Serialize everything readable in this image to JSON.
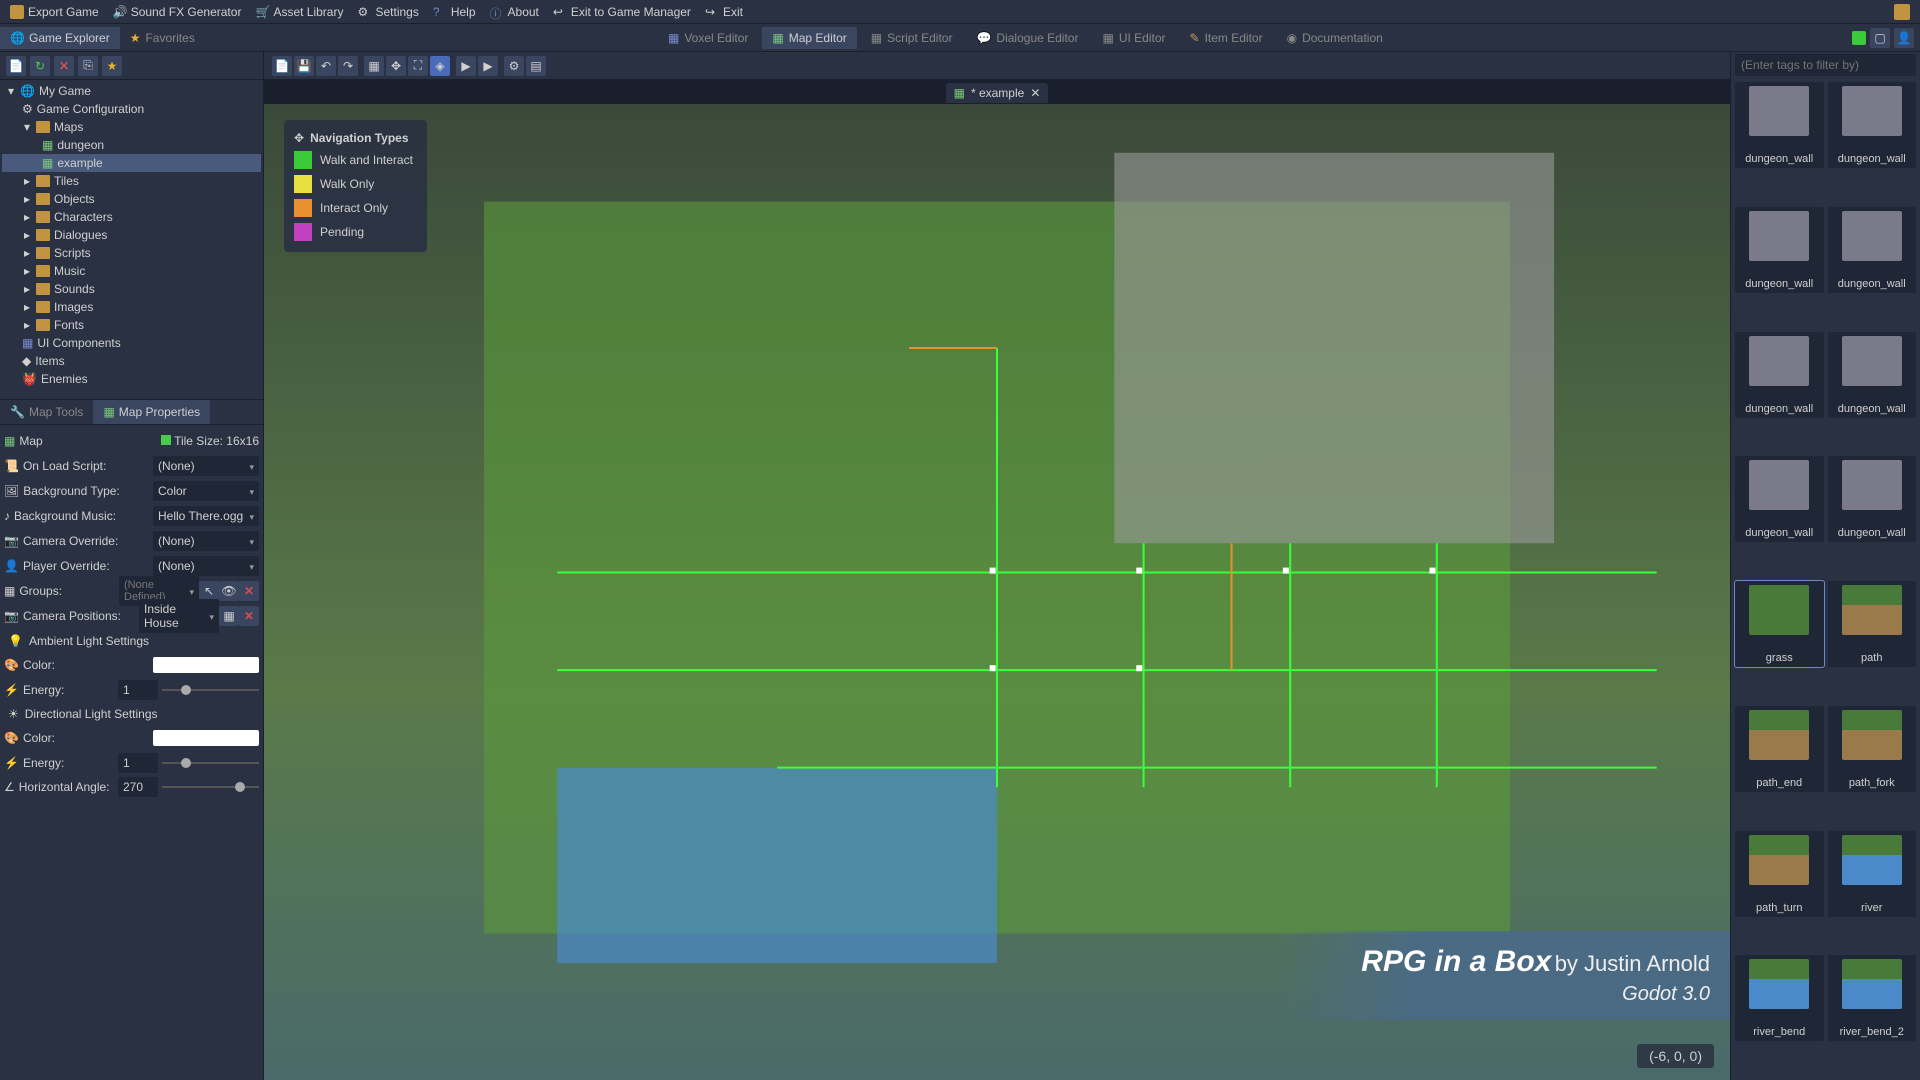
{
  "menubar": [
    {
      "label": "Export Game",
      "icon": "box"
    },
    {
      "label": "Sound FX Generator",
      "icon": "sound"
    },
    {
      "label": "Asset Library",
      "icon": "cart"
    },
    {
      "label": "Settings",
      "icon": "gear"
    },
    {
      "label": "Help",
      "icon": "help"
    },
    {
      "label": "About",
      "icon": "info"
    },
    {
      "label": "Exit to Game Manager",
      "icon": "exit"
    },
    {
      "label": "Exit",
      "icon": "exit"
    }
  ],
  "explorer": {
    "title": "Game Explorer",
    "favorites": "Favorites",
    "root": "My Game",
    "items": [
      {
        "label": "Game Configuration",
        "indent": 1,
        "icon": "gear"
      },
      {
        "label": "Maps",
        "indent": 1,
        "icon": "folder",
        "expanded": true
      },
      {
        "label": "dungeon",
        "indent": 2,
        "icon": "map"
      },
      {
        "label": "example",
        "indent": 2,
        "icon": "map",
        "selected": true
      },
      {
        "label": "Tiles",
        "indent": 1,
        "icon": "folder"
      },
      {
        "label": "Objects",
        "indent": 1,
        "icon": "folder"
      },
      {
        "label": "Characters",
        "indent": 1,
        "icon": "folder"
      },
      {
        "label": "Dialogues",
        "indent": 1,
        "icon": "folder"
      },
      {
        "label": "Scripts",
        "indent": 1,
        "icon": "folder"
      },
      {
        "label": "Music",
        "indent": 1,
        "icon": "folder"
      },
      {
        "label": "Sounds",
        "indent": 1,
        "icon": "folder"
      },
      {
        "label": "Images",
        "indent": 1,
        "icon": "folder"
      },
      {
        "label": "Fonts",
        "indent": 1,
        "icon": "folder"
      },
      {
        "label": "UI Components",
        "indent": 1,
        "icon": "ui"
      },
      {
        "label": "Items",
        "indent": 1,
        "icon": "item"
      },
      {
        "label": "Enemies",
        "indent": 1,
        "icon": "enemy"
      }
    ]
  },
  "prop_tabs": {
    "map_tools": "Map Tools",
    "map_properties": "Map Properties"
  },
  "map_header": {
    "map": "Map",
    "tile_size": "Tile Size: 16x16"
  },
  "properties": {
    "on_load_script": {
      "label": "On Load Script:",
      "value": "(None)"
    },
    "background_type": {
      "label": "Background Type:",
      "value": "Color"
    },
    "background_music": {
      "label": "Background Music:",
      "value": "Hello There.ogg"
    },
    "camera_override": {
      "label": "Camera Override:",
      "value": "(None)"
    },
    "player_override": {
      "label": "Player Override:",
      "value": "(None)"
    },
    "groups": {
      "label": "Groups:",
      "value": "(None Defined)"
    },
    "camera_positions": {
      "label": "Camera Positions:",
      "value": "Inside House"
    },
    "ambient_header": "Ambient Light Settings",
    "ambient_color": {
      "label": "Color:"
    },
    "ambient_energy": {
      "label": "Energy:",
      "value": "1"
    },
    "directional_header": "Directional Light Settings",
    "dir_color": {
      "label": "Color:"
    },
    "dir_energy": {
      "label": "Energy:",
      "value": "1"
    },
    "horizontal_angle": {
      "label": "Horizontal Angle:",
      "value": "270"
    }
  },
  "editor_tabs": [
    {
      "label": "Voxel Editor"
    },
    {
      "label": "Map Editor",
      "active": true
    },
    {
      "label": "Script Editor"
    },
    {
      "label": "Dialogue Editor"
    },
    {
      "label": "UI Editor"
    },
    {
      "label": "Item Editor"
    },
    {
      "label": "Documentation"
    }
  ],
  "file_tab": {
    "label": "* example"
  },
  "nav_legend": {
    "title": "Navigation Types",
    "items": [
      {
        "color": "#3aca3a",
        "label": "Walk and Interact"
      },
      {
        "color": "#e8e040",
        "label": "Walk Only"
      },
      {
        "color": "#e89030",
        "label": "Interact Only"
      },
      {
        "color": "#c040c0",
        "label": "Pending"
      }
    ]
  },
  "coords": "(-6, 0, 0)",
  "credit": {
    "title": "RPG in a Box",
    "by": "by Justin Arnold",
    "engine": "Godot 3.0"
  },
  "right": {
    "filter_placeholder": "(Enter tags to filter by)",
    "assets": [
      {
        "label": "dungeon_wall"
      },
      {
        "label": "dungeon_wall"
      },
      {
        "label": "dungeon_wall"
      },
      {
        "label": "dungeon_wall"
      },
      {
        "label": "dungeon_wall"
      },
      {
        "label": "dungeon_wall"
      },
      {
        "label": "dungeon_wall"
      },
      {
        "label": "dungeon_wall"
      },
      {
        "label": "grass",
        "selected": true
      },
      {
        "label": "path"
      },
      {
        "label": "path_end"
      },
      {
        "label": "path_fork"
      },
      {
        "label": "path_turn"
      },
      {
        "label": "river"
      },
      {
        "label": "river_bend"
      },
      {
        "label": "river_bend_2"
      }
    ]
  }
}
